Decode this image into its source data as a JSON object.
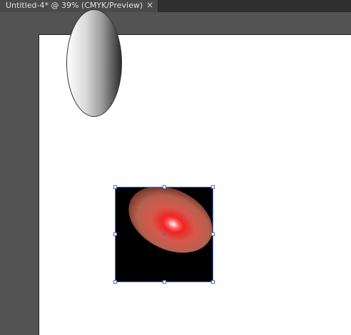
{
  "window": {
    "document_tab": {
      "title": "Untitled-4* @ 39% (CMYK/Preview)",
      "close_glyph": "×"
    }
  },
  "colors": {
    "workspace_background": "#535353",
    "artboard": "#ffffff",
    "selection": "#4f6fd6",
    "square_fill": "#000000",
    "glow_core": "#ffffff",
    "glow_red": "#ee2424"
  },
  "artwork": {
    "objects": [
      {
        "name": "ellipse",
        "fill": "linear gradient white to black",
        "selected": false
      },
      {
        "name": "square",
        "fill": "radial gradient red glow on black",
        "selected": true
      }
    ]
  },
  "icons": {
    "close": "close-icon"
  }
}
